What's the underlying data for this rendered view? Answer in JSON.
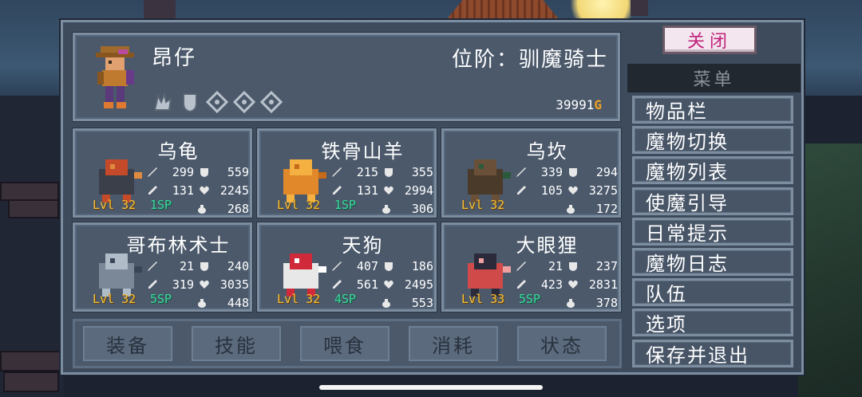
{
  "hero": {
    "name": "昂仔",
    "rank": "位阶：驯魔骑士",
    "gold_value": "39991",
    "gold_unit": "G",
    "badges": [
      "claw-badge-icon",
      "shield-badge-icon",
      "empty-badge-icon",
      "empty-badge-icon",
      "empty-badge-icon"
    ]
  },
  "monsters": [
    {
      "name": "乌龟",
      "atk": "299",
      "def": "559",
      "mag": "131",
      "hp": "2245",
      "lvl": "Lvl 32",
      "sp": "1SP",
      "mana": "268"
    },
    {
      "name": "铁骨山羊",
      "atk": "215",
      "def": "355",
      "mag": "131",
      "hp": "2994",
      "lvl": "Lvl 32",
      "sp": "1SP",
      "mana": "306"
    },
    {
      "name": "乌坎",
      "atk": "339",
      "def": "294",
      "mag": "105",
      "hp": "3275",
      "lvl": "Lvl 32",
      "sp": "",
      "mana": "172"
    },
    {
      "name": "哥布林术士",
      "atk": "21",
      "def": "240",
      "mag": "319",
      "hp": "3035",
      "lvl": "Lvl 32",
      "sp": "5SP",
      "mana": "448"
    },
    {
      "name": "天狗",
      "atk": "407",
      "def": "186",
      "mag": "561",
      "hp": "2495",
      "lvl": "Lvl 32",
      "sp": "4SP",
      "mana": "553"
    },
    {
      "name": "大眼狸",
      "atk": "21",
      "def": "237",
      "mag": "423",
      "hp": "2831",
      "lvl": "Lvl 33",
      "sp": "5SP",
      "mana": "378"
    }
  ],
  "tabs": [
    "装备",
    "技能",
    "喂食",
    "消耗",
    "状态"
  ],
  "close_label": "关闭",
  "menu": {
    "title": "菜单",
    "items": [
      "物品栏",
      "魔物切换",
      "魔物列表",
      "使魔引导",
      "日常提示",
      "魔物日志",
      "队伍",
      "选项",
      "保存并退出"
    ]
  },
  "colors": {
    "level": "#f5c23a",
    "sp": "#3fd6a0",
    "gold_icon": "#f0a020",
    "close_text": "#c0247d"
  }
}
